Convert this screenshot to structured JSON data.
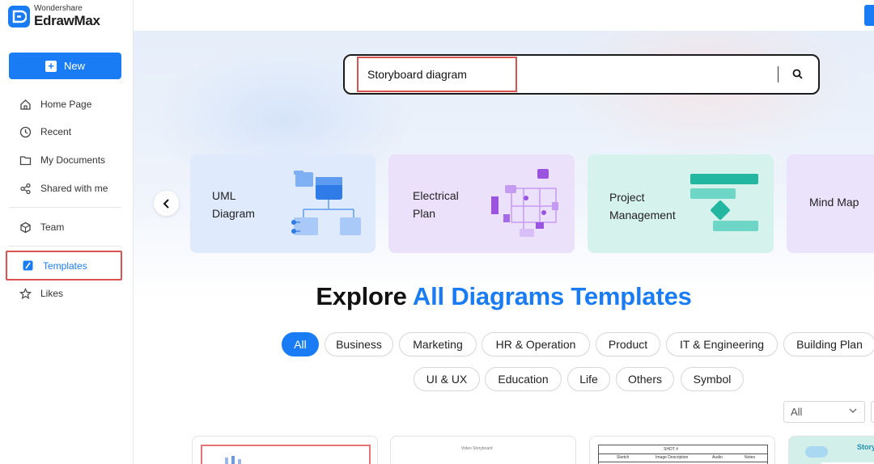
{
  "app": {
    "brand": "Wondershare",
    "name": "EdrawMax"
  },
  "sidebar": {
    "new_label": "New",
    "items": [
      {
        "label": "Home Page",
        "icon": "home-icon"
      },
      {
        "label": "Recent",
        "icon": "clock-icon"
      },
      {
        "label": "My Documents",
        "icon": "folder-icon"
      },
      {
        "label": "Shared with me",
        "icon": "share-icon"
      },
      {
        "label": "Team",
        "icon": "team-icon"
      },
      {
        "label": "Templates",
        "icon": "templates-icon",
        "active": true
      },
      {
        "label": "Likes",
        "icon": "star-icon"
      }
    ]
  },
  "search": {
    "value": "Storyboard diagram"
  },
  "categories": [
    {
      "line1": "UML",
      "line2": "Diagram"
    },
    {
      "line1": "Electrical",
      "line2": "Plan"
    },
    {
      "line1": "Project",
      "line2": "Management"
    },
    {
      "line1": "Mind Map",
      "line2": ""
    }
  ],
  "heading": {
    "part1": "Explore",
    "part2": "All Diagrams Templates"
  },
  "filters": {
    "row1": [
      "All",
      "Business",
      "Marketing",
      "HR & Operation",
      "Product",
      "IT & Engineering",
      "Building Plan"
    ],
    "row2": [
      "UI & UX",
      "Education",
      "Life",
      "Others",
      "Symbol"
    ],
    "active": "All"
  },
  "sort_select": {
    "value": "All"
  },
  "thumbnails": [
    {
      "caption": ""
    },
    {
      "caption": "Video Storyboard"
    },
    {
      "caption": "SHOT #",
      "columns": [
        "Sketch",
        "Image Description",
        "Audio",
        "Notes"
      ]
    },
    {
      "caption": "Story"
    }
  ],
  "colors": {
    "accent": "#1a7cf5",
    "highlight": "#d9534f"
  }
}
